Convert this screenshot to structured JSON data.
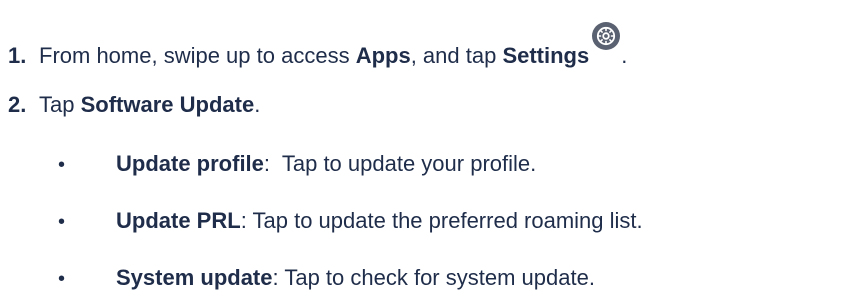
{
  "steps": [
    {
      "number": "1.",
      "text_before_apps": "From home, swipe up to access ",
      "apps_label": "Apps",
      "text_middle": ", and tap ",
      "settings_label": "Settings",
      "text_end": ".",
      "icon": "settings-gear-icon"
    },
    {
      "number": "2.",
      "text_before": "Tap ",
      "bold_label": "Software Update",
      "text_end": "."
    }
  ],
  "bullets": [
    {
      "marker": "•",
      "label": "Update profile",
      "separator": ":  ",
      "description": "Tap to update your profile."
    },
    {
      "marker": "•",
      "label": "Update PRL",
      "separator": ": ",
      "description": "Tap to update the preferred roaming list."
    },
    {
      "marker": "•",
      "label": "System update",
      "separator": ": ",
      "description": "Tap to check for system update."
    }
  ],
  "colors": {
    "text": "#1f2d4a",
    "icon_fill": "#5a6170"
  }
}
